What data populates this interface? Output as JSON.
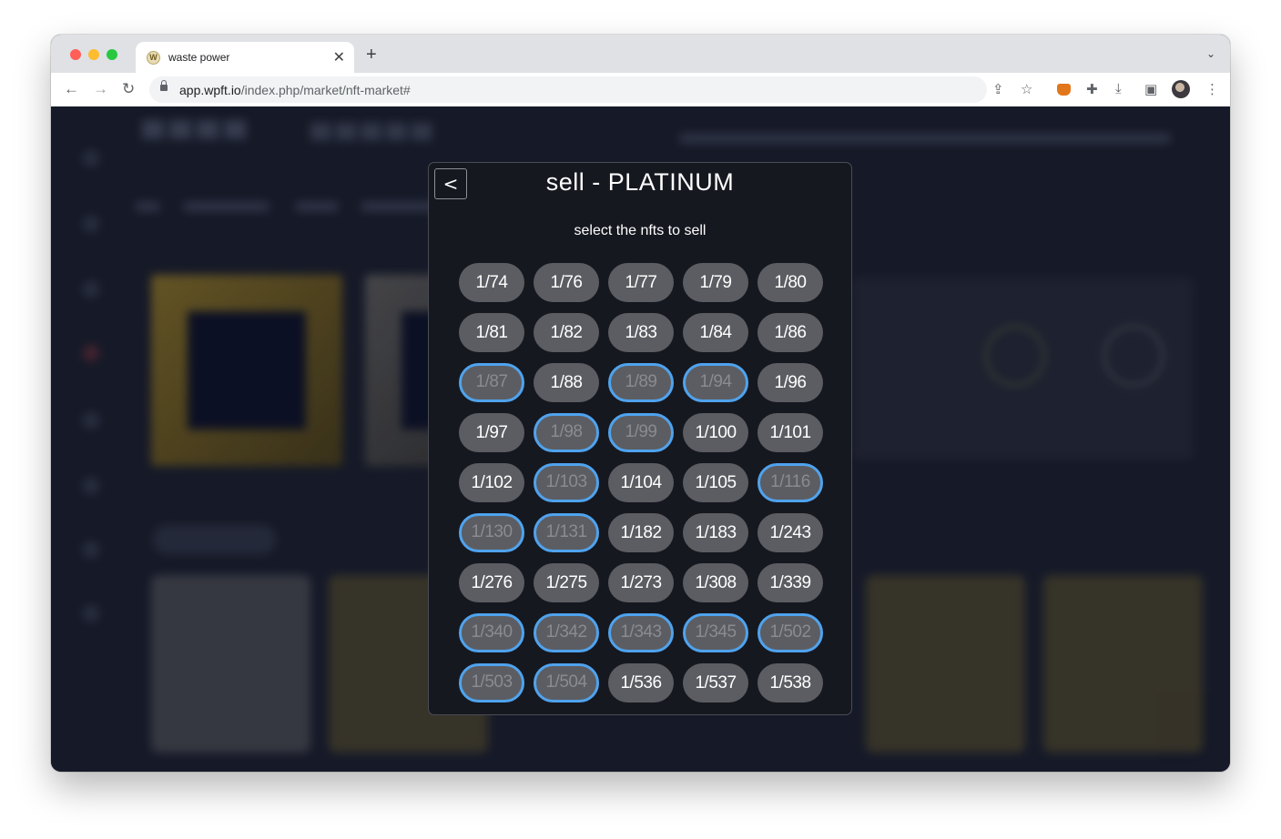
{
  "browser": {
    "tab_title": "waste power",
    "tab_favicon": "W",
    "url_host": "app.wpft.io",
    "url_path": "/index.php/market/nft-market#"
  },
  "modal": {
    "back_label": "<",
    "title": "sell - PLATINUM",
    "hint": "select the nfts to sell",
    "selected_color": "#4fa3ee",
    "nfts": [
      {
        "label": "1/74",
        "selected": false
      },
      {
        "label": "1/76",
        "selected": false
      },
      {
        "label": "1/77",
        "selected": false
      },
      {
        "label": "1/79",
        "selected": false
      },
      {
        "label": "1/80",
        "selected": false
      },
      {
        "label": "1/81",
        "selected": false
      },
      {
        "label": "1/82",
        "selected": false
      },
      {
        "label": "1/83",
        "selected": false
      },
      {
        "label": "1/84",
        "selected": false
      },
      {
        "label": "1/86",
        "selected": false
      },
      {
        "label": "1/87",
        "selected": true
      },
      {
        "label": "1/88",
        "selected": false
      },
      {
        "label": "1/89",
        "selected": true
      },
      {
        "label": "1/94",
        "selected": true
      },
      {
        "label": "1/96",
        "selected": false
      },
      {
        "label": "1/97",
        "selected": false
      },
      {
        "label": "1/98",
        "selected": true
      },
      {
        "label": "1/99",
        "selected": true
      },
      {
        "label": "1/100",
        "selected": false
      },
      {
        "label": "1/101",
        "selected": false
      },
      {
        "label": "1/102",
        "selected": false
      },
      {
        "label": "1/103",
        "selected": true
      },
      {
        "label": "1/104",
        "selected": false
      },
      {
        "label": "1/105",
        "selected": false
      },
      {
        "label": "1/116",
        "selected": true
      },
      {
        "label": "1/130",
        "selected": true
      },
      {
        "label": "1/131",
        "selected": true
      },
      {
        "label": "1/182",
        "selected": false
      },
      {
        "label": "1/183",
        "selected": false
      },
      {
        "label": "1/243",
        "selected": false
      },
      {
        "label": "1/276",
        "selected": false
      },
      {
        "label": "1/275",
        "selected": false
      },
      {
        "label": "1/273",
        "selected": false
      },
      {
        "label": "1/308",
        "selected": false
      },
      {
        "label": "1/339",
        "selected": false
      },
      {
        "label": "1/340",
        "selected": true
      },
      {
        "label": "1/342",
        "selected": true
      },
      {
        "label": "1/343",
        "selected": true
      },
      {
        "label": "1/345",
        "selected": true
      },
      {
        "label": "1/502",
        "selected": true
      },
      {
        "label": "1/503",
        "selected": true
      },
      {
        "label": "1/504",
        "selected": true
      },
      {
        "label": "1/536",
        "selected": false
      },
      {
        "label": "1/537",
        "selected": false
      },
      {
        "label": "1/538",
        "selected": false
      }
    ]
  }
}
